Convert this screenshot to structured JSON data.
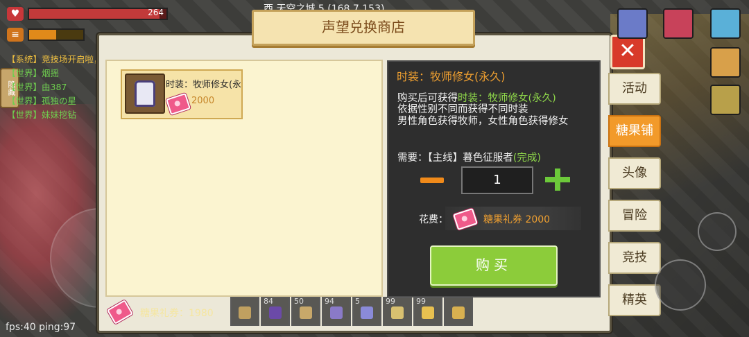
{
  "hud": {
    "hp_value": "264",
    "hp_fraction": 0.95,
    "hunger_fraction": 0.5,
    "location": "西 天空之城 5 (168,7,153)",
    "fps": "fps:40 ping:97",
    "chat_side_label": "隐藏"
  },
  "chat": [
    {
      "channel": "【系统】",
      "text": "竞技场开启啦，点击右侧按钮报名参与，赢取积分和奖励",
      "kind": "sys"
    },
    {
      "channel": "【世界】",
      "text": "烟摇",
      "kind": "world"
    },
    {
      "channel": "【世界】",
      "text": "由387",
      "kind": "world"
    },
    {
      "channel": "【世界】",
      "text": "孤独の星",
      "kind": "world"
    },
    {
      "channel": "【世界】",
      "text": "妹妹挖钻",
      "kind": "world"
    }
  ],
  "shop": {
    "title": "声望兑换商店",
    "close_label": "✕",
    "items": [
      {
        "name": "时装：牧师修女(永久)",
        "price": "2000",
        "icon": "priest-robe-icon"
      }
    ],
    "balance_label": "糖果礼券：1980"
  },
  "detail": {
    "title": "时装：牧师修女(永久)",
    "obtain_prefix": "购买后可获得",
    "obtain_item": "时装：牧师修女(永久)",
    "description": "依据性别不同而获得不同时装\n男性角色获得牧师，女性角色获得修女",
    "requirement_prefix": "需要：【主线】暮色征服者",
    "requirement_status": "(完成)",
    "quantity": "1",
    "cost_label": "花费：",
    "cost_value": "糖果礼券 2000",
    "buy_label": "购买"
  },
  "tabs": [
    {
      "label": "活动",
      "active": false
    },
    {
      "label": "糖果铺",
      "active": true
    },
    {
      "label": "头像",
      "active": false
    },
    {
      "label": "冒险",
      "active": false
    },
    {
      "label": "竞技",
      "active": false
    },
    {
      "label": "精英",
      "active": false
    }
  ],
  "hotbar": [
    {
      "count": "",
      "icon": "sword-icon"
    },
    {
      "count": "84",
      "icon": "book-icon"
    },
    {
      "count": "50",
      "icon": "scroll-icon"
    },
    {
      "count": "94",
      "icon": "bow-icon"
    },
    {
      "count": "5",
      "icon": "potion-icon"
    },
    {
      "count": "99",
      "icon": "fruit-icon"
    },
    {
      "count": "99",
      "icon": "gold-icon"
    },
    {
      "count": "",
      "icon": "bag-icon"
    }
  ],
  "colors": {
    "accent_orange": "#f29a2a",
    "buy_green": "#8ccc3a",
    "highlight_green": "#8fd84a",
    "price_orange": "#f0a030"
  }
}
